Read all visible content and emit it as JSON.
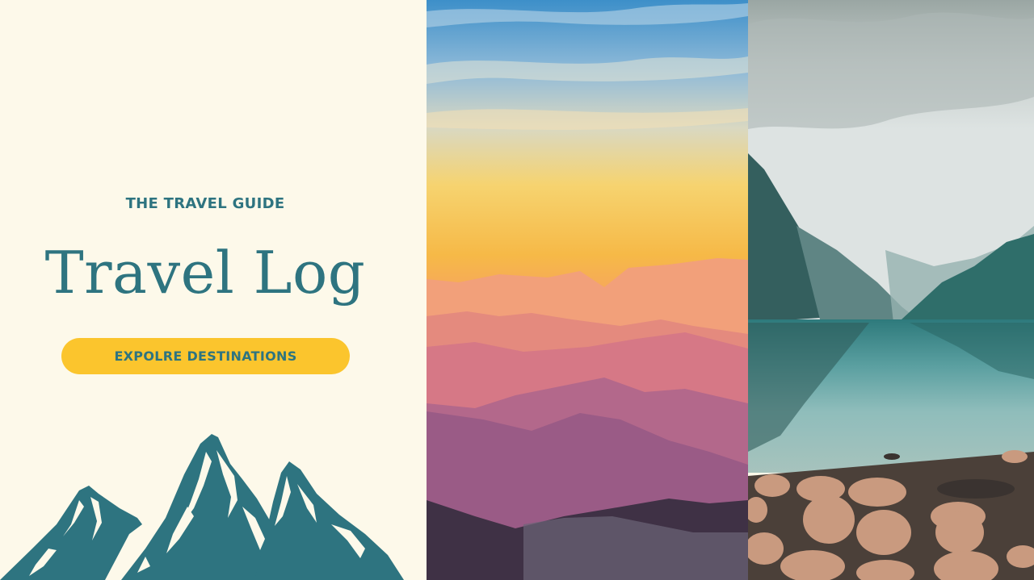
{
  "colors": {
    "background": "#fdf9ea",
    "teal": "#2e7480",
    "accent": "#fbc52d"
  },
  "hero": {
    "kicker": "THE TRAVEL GUIDE",
    "title": "Travel Log",
    "cta_label": "EXPOLRE DESTINATIONS"
  },
  "decorations": {
    "mountain_illustration": "mountain-peaks-icon"
  },
  "images": [
    {
      "name": "sunset-mountains-photo"
    },
    {
      "name": "mountain-lake-photo"
    }
  ]
}
